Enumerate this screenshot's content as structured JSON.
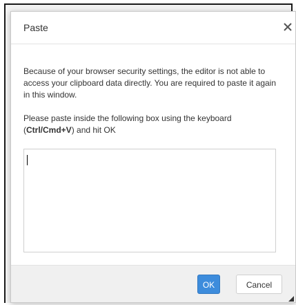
{
  "dialog": {
    "title": "Paste",
    "close_icon": "close-icon",
    "paragraph1": "Because of your browser security settings, the editor is not able to access your clipboard data directly. You are required to paste it again in this window.",
    "paragraph2_before": "Please paste inside the following box using the keyboard (",
    "paragraph2_shortcut": "Ctrl/Cmd+V",
    "paragraph2_after": ") and hit OK",
    "paste_box_value": "",
    "ok_label": "OK",
    "cancel_label": "Cancel",
    "accent_color": "#3d8cdc"
  }
}
